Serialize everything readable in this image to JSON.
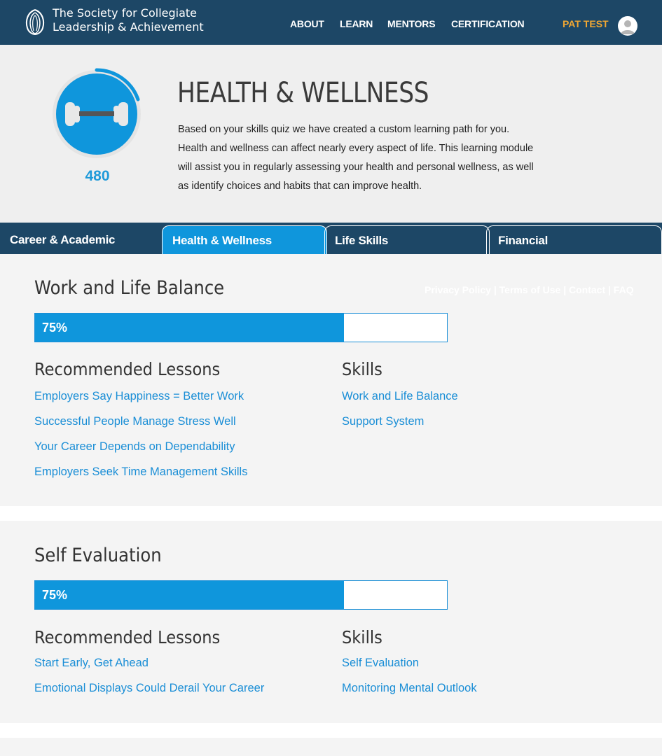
{
  "header": {
    "logo_line1": "The Society for Collegiate",
    "logo_line2": "Leadership & Achievement",
    "nav": [
      "ABOUT",
      "LEARN",
      "MENTORS",
      "CERTIFICATION"
    ],
    "user_name": "PAT TEST",
    "icons": {
      "logo": "laurel-logo-icon",
      "avatar": "user-avatar-icon"
    }
  },
  "hero": {
    "title": "HEALTH & WELLNESS",
    "description": "Based on your skills quiz we have created a custom learning path for you. Health and wellness can affect nearly every aspect of life. This learning module will assist you in regularly assessing your health and personal wellness, as well as identify choices and habits that can improve health.",
    "score": "480",
    "icon": "dumbbell-icon"
  },
  "tabs": [
    "Career & Academic",
    "Health & Wellness",
    "Life Skills",
    "Financial"
  ],
  "active_tab": "Health & Wellness",
  "footer_links": "Privacy Policy | Terms of Use | Contact | FAQ",
  "modules": [
    {
      "title": "Work and Life Balance",
      "progress_label": "75%",
      "progress": 0.75,
      "lessons_heading": "Recommended Lessons",
      "lessons": [
        "Employers Say Happiness = Better Work",
        "Successful People Manage Stress Well",
        "Your Career Depends on Dependability",
        "Employers Seek Time Management Skills"
      ],
      "skills_heading": "Skills",
      "skills": [
        "Work and Life Balance",
        "Support System"
      ]
    },
    {
      "title": "Self Evaluation",
      "progress_label": "75%",
      "progress": 0.75,
      "lessons_heading": "Recommended Lessons",
      "lessons": [
        "Start Early, Get Ahead",
        "Emotional Displays Could Derail Your Career"
      ],
      "skills_heading": "Skills",
      "skills": [
        "Self Evaluation",
        "Monitoring Mental Outlook"
      ]
    }
  ],
  "colors": {
    "header_bg": "#1d4766",
    "accent_blue": "#0f96dc",
    "link_blue": "#1a8ed6",
    "user_orange": "#f0a733",
    "panel_bg": "#f4f4f4",
    "hero_bg": "#efefef"
  }
}
